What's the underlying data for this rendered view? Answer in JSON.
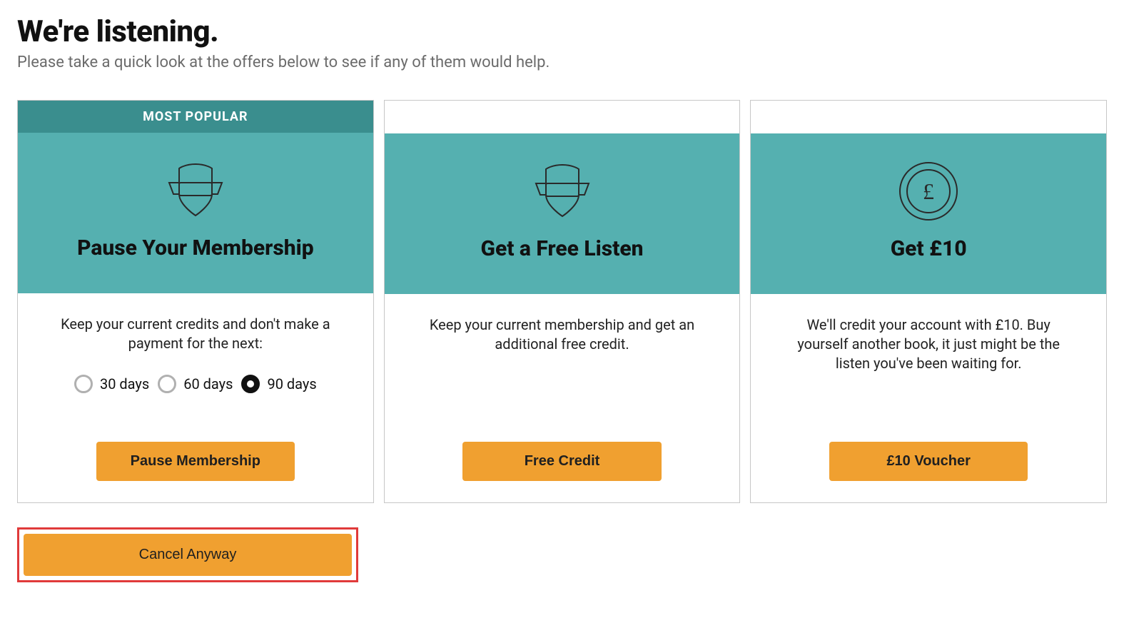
{
  "heading": "We're listening.",
  "subtitle": "Please take a quick look at the offers below to see if any of them would help.",
  "badge": "MOST POPULAR",
  "cards": [
    {
      "title": "Pause Your Membership",
      "text": "Keep your current credits and don't make a payment for the next:",
      "button": "Pause Membership"
    },
    {
      "title": "Get a Free Listen",
      "text": "Keep your current membership and get an additional free credit.",
      "button": "Free Credit"
    },
    {
      "title": "Get £10",
      "text": "We'll credit your account with £10. Buy yourself another book, it just might be the listen you've been waiting for.",
      "button": "£10 Voucher"
    }
  ],
  "pause_options": {
    "opt0": "30 days",
    "opt1": "60 days",
    "opt2": "90 days",
    "selected_index": 2
  },
  "cancel_button": "Cancel Anyway",
  "colors": {
    "teal": "#55b0b0",
    "teal_dark": "#3a8e8e",
    "orange": "#f0a030",
    "highlight_border": "#e03a3a"
  }
}
